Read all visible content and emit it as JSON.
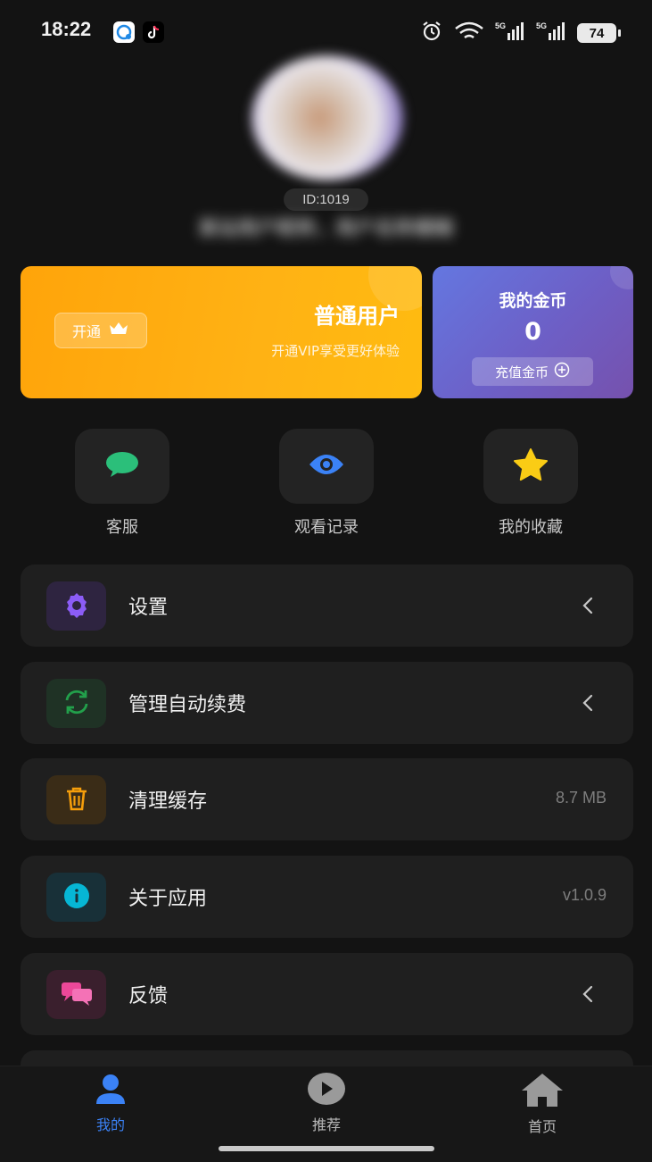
{
  "status_bar": {
    "time": "18:22",
    "battery": "74"
  },
  "profile": {
    "id_label": "ID:1019",
    "nickname": "某站用户昵称，用户名称模糊"
  },
  "vip_card": {
    "open_label": "开通",
    "title": "普通用户",
    "subtitle": "开通VIP享受更好体验",
    "accent": "#FFAC0E"
  },
  "coin_card": {
    "title": "我的金币",
    "value": "0",
    "recharge_label": "充值金币"
  },
  "quick_actions": [
    {
      "label": "客服",
      "icon": "chat-bubble-icon",
      "color": "#2bbf7a"
    },
    {
      "label": "观看记录",
      "icon": "eye-icon",
      "color": "#3b82f6"
    },
    {
      "label": "我的收藏",
      "icon": "star-icon",
      "color": "#facc15"
    }
  ],
  "menu": [
    {
      "label": "设置",
      "icon": "gear-icon",
      "color": "#8b5cf6",
      "trail": ""
    },
    {
      "label": "管理自动续费",
      "icon": "refresh-icon",
      "color": "#22a04b",
      "trail": ""
    },
    {
      "label": "清理缓存",
      "icon": "trash-icon",
      "color": "#f59e0b",
      "trail": "8.7 MB"
    },
    {
      "label": "关于应用",
      "icon": "info-icon",
      "color": "#06b6d4",
      "trail": "v1.0.9"
    },
    {
      "label": "反馈",
      "icon": "feedback-icon",
      "color": "#ec4899",
      "trail": ""
    }
  ],
  "bottom_nav": [
    {
      "label": "我的",
      "icon": "user-icon",
      "active": true,
      "color": "#3b82f6"
    },
    {
      "label": "推荐",
      "icon": "play-icon",
      "active": false,
      "color": "#9a9a9a"
    },
    {
      "label": "首页",
      "icon": "home-icon",
      "active": false,
      "color": "#9a9a9a"
    }
  ]
}
